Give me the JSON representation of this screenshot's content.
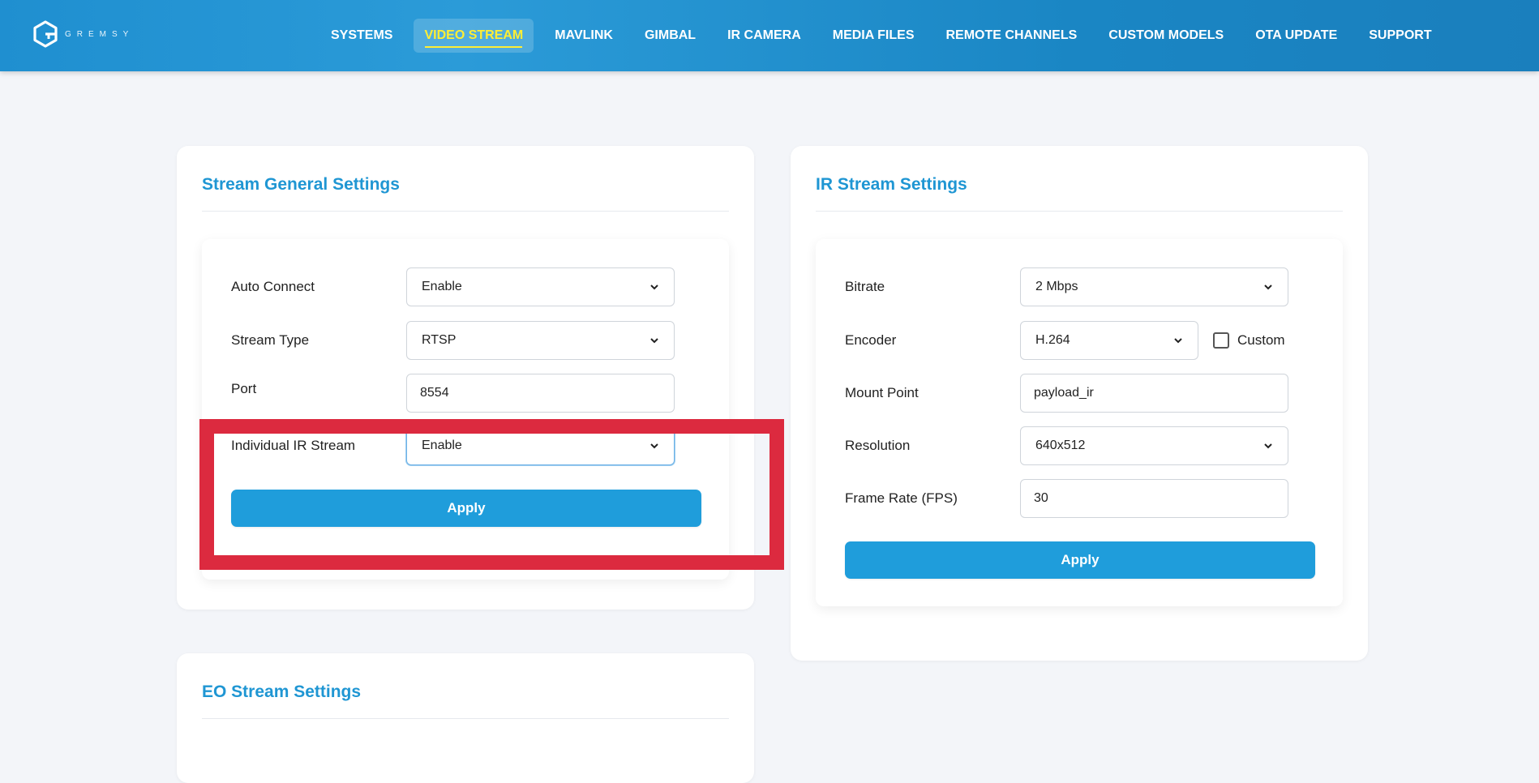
{
  "header": {
    "logo_text": "GREMSY",
    "nav": [
      {
        "label": "SYSTEMS",
        "active": false
      },
      {
        "label": "VIDEO STREAM",
        "active": true
      },
      {
        "label": "MAVLINK",
        "active": false
      },
      {
        "label": "GIMBAL",
        "active": false
      },
      {
        "label": "IR CAMERA",
        "active": false
      },
      {
        "label": "MEDIA FILES",
        "active": false
      },
      {
        "label": "REMOTE CHANNELS",
        "active": false
      },
      {
        "label": "CUSTOM MODELS",
        "active": false
      },
      {
        "label": "OTA UPDATE",
        "active": false
      },
      {
        "label": "SUPPORT",
        "active": false
      }
    ]
  },
  "general": {
    "title": "Stream General Settings",
    "auto_connect": {
      "label": "Auto Connect",
      "value": "Enable"
    },
    "stream_type": {
      "label": "Stream Type",
      "value": "RTSP"
    },
    "port": {
      "label": "Port",
      "value": "8554"
    },
    "individual_ir": {
      "label": "Individual IR Stream",
      "value": "Enable"
    },
    "apply": "Apply"
  },
  "ir": {
    "title": "IR Stream Settings",
    "bitrate": {
      "label": "Bitrate",
      "value": "2 Mbps"
    },
    "encoder": {
      "label": "Encoder",
      "value": "H.264",
      "custom_label": "Custom",
      "custom_checked": false
    },
    "mount_point": {
      "label": "Mount Point",
      "value": "payload_ir"
    },
    "resolution": {
      "label": "Resolution",
      "value": "640x512"
    },
    "frame_rate": {
      "label": "Frame Rate (FPS)",
      "value": "30"
    },
    "apply": "Apply"
  },
  "eo": {
    "title": "EO Stream Settings"
  },
  "colors": {
    "accent": "#1f9ddb",
    "active_nav": "#ffee33",
    "highlight": "#dc2a3f"
  }
}
